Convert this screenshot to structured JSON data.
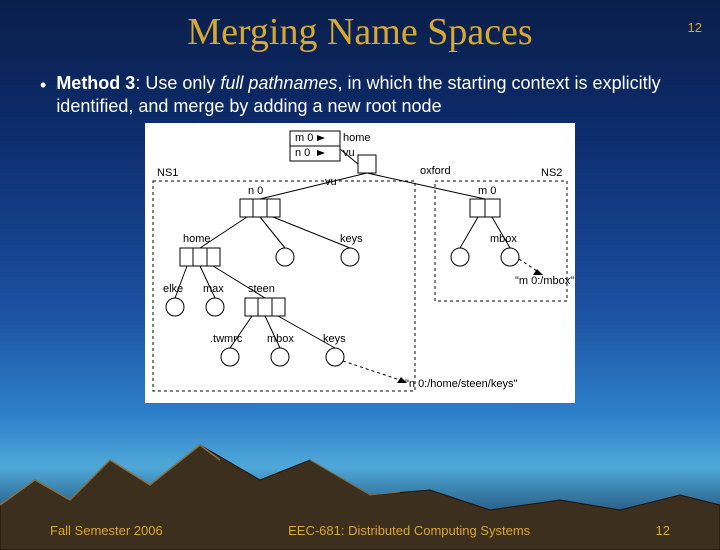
{
  "slide": {
    "number_top": "12",
    "title": "Merging Name Spaces",
    "bullet": {
      "method_label": "Method 3",
      "rest1": ": Use only ",
      "ital": "full pathnames",
      "rest2": ", in which the starting context is explicitly identified, and merge by adding a new root node"
    }
  },
  "diagram": {
    "root_map1": "m 0",
    "root_map1_val": "home",
    "root_map2": "n 0",
    "root_map2_val": "vu",
    "ns1": "NS1",
    "ns2": "NS2",
    "n0": "n 0",
    "m0": "m 0",
    "vu": "vu",
    "oxford": "oxford",
    "home": "home",
    "keys": "keys",
    "mbox": "mbox",
    "elke": "elke",
    "max": "max",
    "steen": "steen",
    "twmrc": ".twmrc",
    "mbox2": "mbox",
    "keys2": "keys",
    "quote1": "\"m 0:/mbox\"",
    "quote2": "\"n 0:/home/steen/keys\""
  },
  "footer": {
    "left": "Fall Semester 2006",
    "center": "EEC-681: Distributed Computing Systems",
    "right": "12"
  }
}
